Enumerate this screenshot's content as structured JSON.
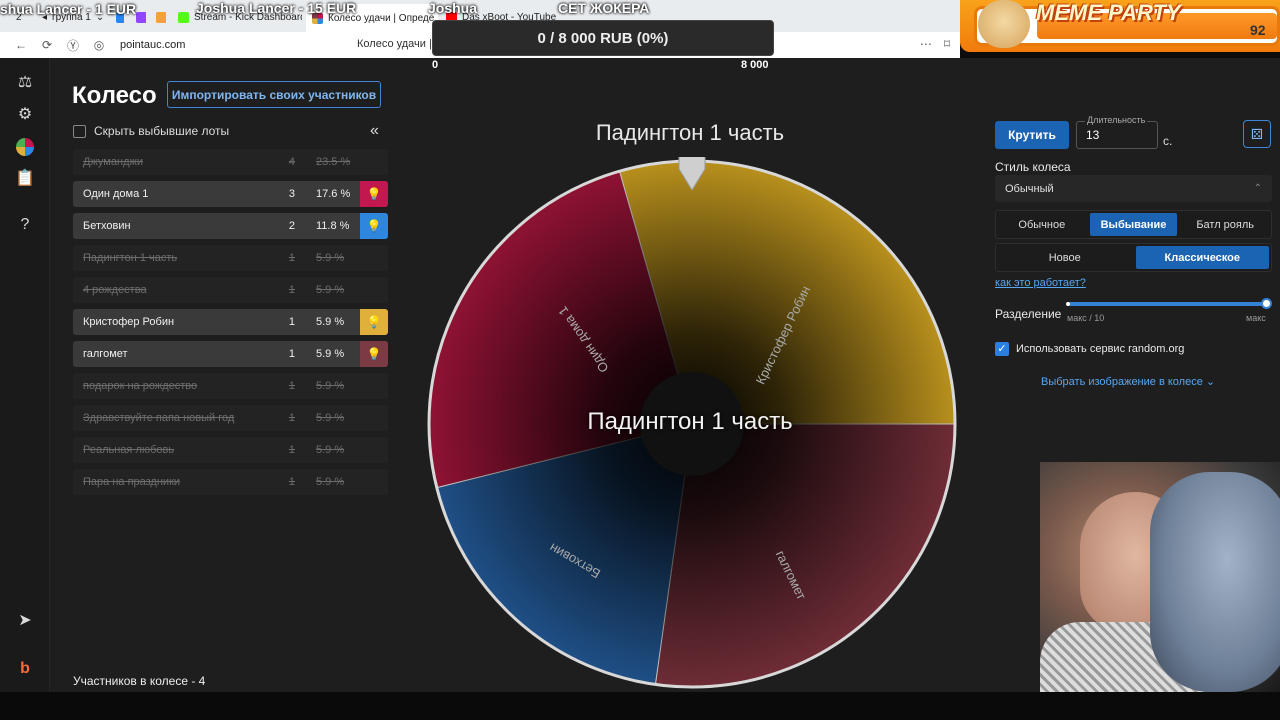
{
  "browser": {
    "tabs": [
      {
        "label": "2",
        "active": false
      },
      {
        "label": "группа 1",
        "active": false
      },
      {
        "label": "Stream - Kick Dashboard",
        "active": false
      },
      {
        "label": "Колесо удачи | Опреде",
        "active": true
      },
      {
        "label": "Das xBoot - YouTube",
        "active": false
      }
    ],
    "url": "pointauc.com",
    "page_title": "Колесо удачи | С"
  },
  "stream_overlay": {
    "donation_left": "shua Lancer - 1 EUR",
    "donation_mid": "Joshua Lancer - 15 EUR",
    "donation_name": "Joshua",
    "donation_right": "СЕТ ЖОКЕРА",
    "goal_text": "0 / 8 000 RUB (0%)",
    "goal_min": "0",
    "goal_max": "8 000",
    "meme_title": "MEME PARTY",
    "meme_value": "92"
  },
  "page": {
    "title": "Колесо",
    "import_button": "Импортировать своих участников",
    "hide_label": "Скрыть выбывшие лоты",
    "collapse_icon": "«",
    "participants_label": "Участников в колесе - 4"
  },
  "lots": [
    {
      "name": "Джуманджи",
      "count": "4",
      "percent": "23.5 %",
      "state": "out"
    },
    {
      "name": "Один дома 1",
      "count": "3",
      "percent": "17.6 %",
      "state": "active",
      "color": "#c2184f"
    },
    {
      "name": "Бетховин",
      "count": "2",
      "percent": "11.8 %",
      "state": "active",
      "color": "#2e86de"
    },
    {
      "name": "Падингтон 1 часть",
      "count": "1",
      "percent": "5.9 %",
      "state": "out"
    },
    {
      "name": "4 рождества",
      "count": "1",
      "percent": "5.9 %",
      "state": "out"
    },
    {
      "name": "Кристофер Робин",
      "count": "1",
      "percent": "5.9 %",
      "state": "active",
      "color": "#e0b13a"
    },
    {
      "name": "галгомет",
      "count": "1",
      "percent": "5.9 %",
      "state": "active",
      "color": "#7a3b45"
    },
    {
      "name": "подарок на рождество",
      "count": "1",
      "percent": "5.9 %",
      "state": "out"
    },
    {
      "name": "Здравствуйте папа новый год",
      "count": "1",
      "percent": "5.9 %",
      "state": "out"
    },
    {
      "name": "Реальная любовь",
      "count": "1",
      "percent": "5.9 %",
      "state": "out"
    },
    {
      "name": "Пара на праздники",
      "count": "1",
      "percent": "5.9 %",
      "state": "out"
    }
  ],
  "wheel": {
    "top_label": "Падингтон 1 часть",
    "center_label": "Падингтон 1 часть",
    "segments": [
      {
        "name": "Кристофер Робин",
        "color": "#b8901d"
      },
      {
        "name": "галгомет",
        "color": "#6e2c36"
      },
      {
        "name": "Бетховин",
        "color": "#1f4f86"
      },
      {
        "name": "Один дома 1",
        "color": "#8f1233"
      }
    ]
  },
  "controls": {
    "spin_button": "Крутить",
    "duration_label": "Длительность",
    "duration_value": "13",
    "seconds_suffix": "с.",
    "style_label": "Стиль колеса",
    "style_value": "Обычный",
    "mode_options": [
      "Обычное",
      "Выбывание",
      "Батл рояль"
    ],
    "mode_selected": "Выбывание",
    "variant_options": [
      "Новое",
      "Классическое"
    ],
    "variant_selected": "Классическое",
    "how_link": "как это работает?",
    "split_label": "Разделение",
    "split_min_label": "макс / 10",
    "split_max_label": "макс",
    "split_value": 1.0,
    "random_org_label": "Использовать сервис random.org",
    "random_org_checked": true,
    "image_link": "Выбрать изображение в колесе"
  }
}
